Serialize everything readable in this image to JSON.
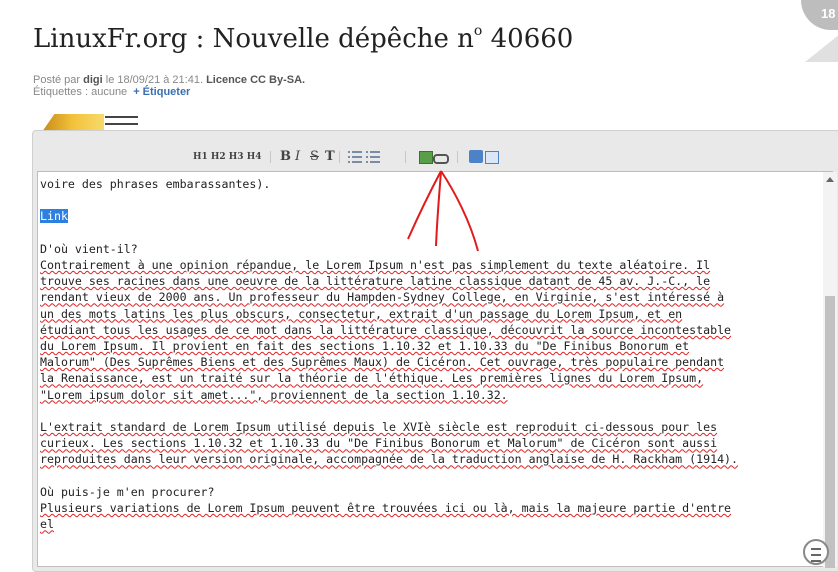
{
  "page": {
    "title": "LinuxFr.org : Nouvelle dépêche n",
    "title_sup": "o",
    "title_num": " 40660",
    "comment_count": "18"
  },
  "meta": {
    "posted_prefix": "Posté par ",
    "author": "digi",
    "date": " le 18/09/21 à 21:41. ",
    "license": "Licence CC By-SA.",
    "tags_label": "Étiquettes : aucune",
    "add_tag": "+ Étiqueter"
  },
  "toolbar": {
    "headings": "H1 H2 H3 H4",
    "bold": "B",
    "italic": "I",
    "strike": "S",
    "code": "T"
  },
  "editor": {
    "line1": "voire des phrases embarassantes).",
    "selected": "Link",
    "heading1": "D'où vient-il?",
    "para1": [
      "Contrairement à une opinion répandue, le Lorem Ipsum n'est pas simplement du texte aléatoire. Il",
      "trouve ses racines dans une oeuvre de la littérature latine classique datant de 45 av. J.-C., le",
      "rendant vieux de 2000 ans. Un professeur du Hampden-Sydney College, en Virginie, s'est intéressé à",
      "un des mots latins les plus obscurs, consectetur, extrait d'un passage du Lorem Ipsum, et en",
      "étudiant tous les usages de ce mot dans la littérature classique, découvrit la source incontestable",
      "du Lorem Ipsum. Il provient en fait des sections 1.10.32 et 1.10.33 du \"De Finibus Bonorum et",
      "Malorum\" (Des Suprêmes Biens et des Suprêmes Maux) de Cicéron. Cet ouvrage, très populaire pendant",
      "la Renaissance, est un traité sur la théorie de l'éthique. Les premières lignes du Lorem Ipsum,",
      "\"Lorem ipsum dolor sit amet...\", proviennent de la section 1.10.32."
    ],
    "para2": [
      "L'extrait standard de Lorem Ipsum utilisé depuis le XVIè siècle est reproduit ci-dessous pour les",
      "curieux. Les sections 1.10.32 et 1.10.33 du \"De Finibus Bonorum et Malorum\" de Cicéron sont aussi",
      "reproduites dans leur version originale, accompagnée de la traduction anglaise de H. Rackham (1914)."
    ],
    "heading2": "Où puis-je m'en procurer?",
    "para3": [
      "Plusieurs variations de Lorem Ipsum peuvent être trouvées ici ou là, mais la majeure partie d'entre",
      "el"
    ]
  },
  "colors": {
    "selection": "#2d7fe0",
    "annotation": "#e11b1b",
    "badge": "#bdbdbd"
  },
  "icons": [
    "image-icon",
    "link-icon",
    "bullet-list-icon",
    "numbered-list-icon",
    "embed-icon",
    "preview-icon",
    "chat-icon"
  ]
}
